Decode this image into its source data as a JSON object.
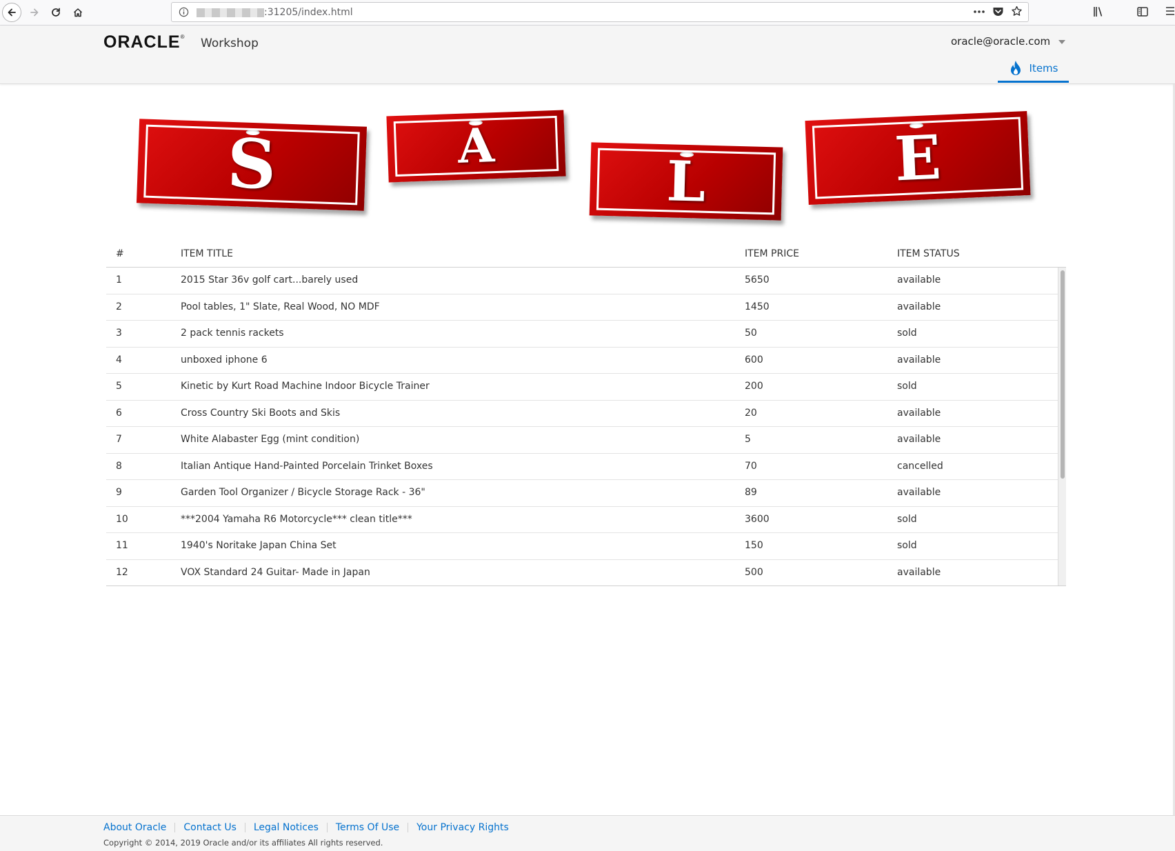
{
  "browser": {
    "url_visible": ":31205/index.html"
  },
  "header": {
    "logo_text": "ORACLE",
    "logo_mark": "®",
    "app_name": "Workshop",
    "user_email": "oracle@oracle.com",
    "nav": {
      "items_label": "Items",
      "items_icon": "flame-icon"
    },
    "accent_color": "#0572ce"
  },
  "banner": {
    "letters": [
      "S",
      "A",
      "L",
      "E"
    ],
    "color": "#c40000"
  },
  "table": {
    "headers": [
      "#",
      "ITEM TITLE",
      "ITEM PRICE",
      "ITEM STATUS"
    ],
    "rows": [
      [
        "1",
        "2015 Star 36v golf cart...barely used",
        "5650",
        "available"
      ],
      [
        "2",
        "Pool tables, 1\" Slate, Real Wood, NO MDF",
        "1450",
        "available"
      ],
      [
        "3",
        "2 pack tennis rackets",
        "50",
        "sold"
      ],
      [
        "4",
        "unboxed iphone 6",
        "600",
        "available"
      ],
      [
        "5",
        "Kinetic by Kurt Road Machine Indoor Bicycle Trainer",
        "200",
        "sold"
      ],
      [
        "6",
        "Cross Country Ski Boots and Skis",
        "20",
        "available"
      ],
      [
        "7",
        "White Alabaster Egg (mint condition)",
        "5",
        "available"
      ],
      [
        "8",
        "Italian Antique Hand-Painted Porcelain Trinket Boxes",
        "70",
        "cancelled"
      ],
      [
        "9",
        "Garden Tool Organizer / Bicycle Storage Rack - 36\"",
        "89",
        "available"
      ],
      [
        "10",
        "***2004 Yamaha R6 Motorcycle*** clean title***",
        "3600",
        "sold"
      ],
      [
        "11",
        "1940's Noritake Japan China Set",
        "150",
        "sold"
      ],
      [
        "12",
        "VOX Standard 24 Guitar- Made in Japan",
        "500",
        "available"
      ]
    ]
  },
  "footer": {
    "links": [
      "About Oracle",
      "Contact Us",
      "Legal Notices",
      "Terms Of Use",
      "Your Privacy Rights"
    ],
    "copyright": "Copyright © 2014, 2019 Oracle and/or its affiliates All rights reserved."
  }
}
